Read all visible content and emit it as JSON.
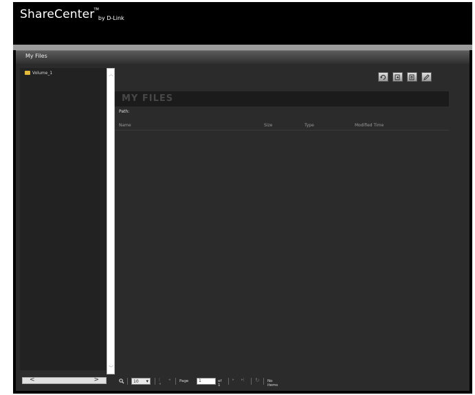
{
  "brand": {
    "name": "ShareCenter",
    "trademark": "TM",
    "byline": "by D-Link"
  },
  "window": {
    "title": "My Files"
  },
  "tree": {
    "items": [
      {
        "label": "Volume_1",
        "icon": "folder-icon"
      }
    ]
  },
  "toolbar": {
    "buttons": [
      {
        "name": "refresh-button",
        "icon": "refresh-icon"
      },
      {
        "name": "new-folder-button",
        "icon": "new-folder-icon"
      },
      {
        "name": "upload-button",
        "icon": "upload-icon"
      },
      {
        "name": "edit-button",
        "icon": "pencil-icon"
      }
    ]
  },
  "panel": {
    "heading": "MY FILES",
    "path_label": "Path:",
    "columns": [
      "Name",
      "Size",
      "Type",
      "Modified Time"
    ]
  },
  "pager": {
    "page_size": "10",
    "page_label": "Page",
    "page_value": "1",
    "of_label": "of 1",
    "status": "No items"
  }
}
